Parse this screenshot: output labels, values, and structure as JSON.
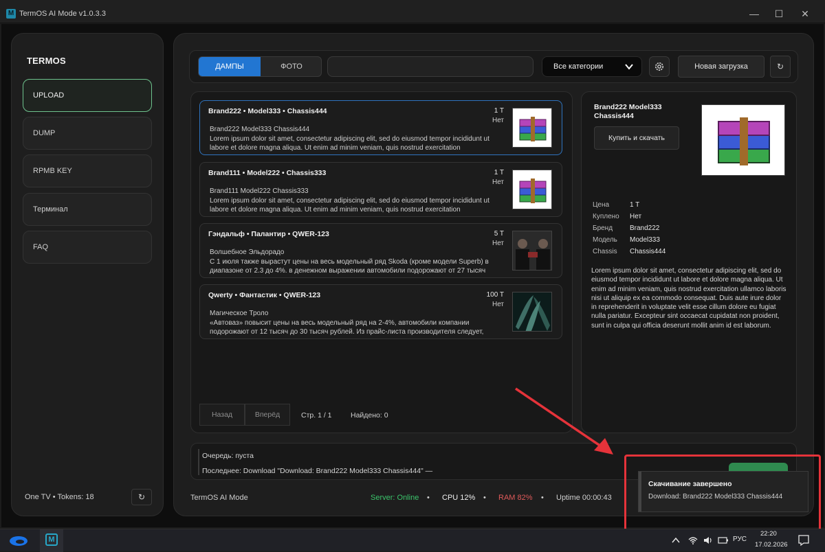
{
  "window": {
    "title": "TermOS AI Mode v1.0.3.3",
    "controls": {
      "minimize": "—",
      "maximize": "☐",
      "close": "✕"
    }
  },
  "sidebar": {
    "brand": "TERMOS",
    "items": [
      {
        "label": "UPLOAD",
        "active": true
      },
      {
        "label": "DUMP"
      },
      {
        "label": "RPMB KEY"
      },
      {
        "label": "Терминал"
      },
      {
        "label": "FAQ"
      }
    ],
    "footer": "One TV • Tokens: 18",
    "refresh_icon": "↻"
  },
  "toolbar": {
    "tabs": [
      {
        "label": "ДАМПЫ",
        "selected": true
      },
      {
        "label": "ФОТО"
      }
    ],
    "search": {
      "value": "",
      "placeholder": ""
    },
    "category": {
      "selected": "Все категории"
    },
    "new_upload_label": "Новая загрузка",
    "refresh_icon": "↻",
    "accent": "#2276d2"
  },
  "list": {
    "items": [
      {
        "title": "Brand222 • Model333 • Chassis444",
        "price": "1 T",
        "bought": "Нет",
        "subtitle": "Brand222 Model333 Chassis444",
        "desc": "Lorem ipsum dolor sit amet, consectetur adipiscing elit, sed do eiusmod tempor incididunt ut labore et dolore magna aliqua. Ut enim ad minim veniam, quis nostrud exercitation",
        "thumb": "archive-icon",
        "selected": true
      },
      {
        "title": "Brand111 • Model222 • Chassis333",
        "price": "1 T",
        "bought": "Нет",
        "subtitle": "Brand111 Model222 Chassis333",
        "desc": "Lorem ipsum dolor sit amet, consectetur adipiscing elit, sed do eiusmod tempor incididunt ut labore et dolore magna aliqua. Ut enim ad minim veniam, quis nostrud exercitation",
        "thumb": "archive-icon"
      },
      {
        "title": "Гэндальф • Палантир • QWER-123",
        "price": "5 T",
        "bought": "Нет",
        "subtitle": "Волшебное Эльдорадо",
        "desc": "С 1 июля также вырастут цены на весь модельный ряд Skoda (кроме модели Superb) в диапазоне от 2.3 до 4%. в денежном выражении автомобили подорожают от 27 тысяч",
        "thumb": "photo-people"
      },
      {
        "title": "Qwerty • Фантастик • QWER-123",
        "price": "100 T",
        "bought": "Нет",
        "subtitle": "Магическое Троло",
        "desc": "«Автоваз» повысит цены на весь модельный ряд на 2-4%, автомобили компании подорожают от 12 тысяч до 30 тысяч рублей. Из прайс-листа производителя следует,",
        "thumb": "photo-leaves"
      }
    ],
    "pager": {
      "prev": "Назад",
      "next": "Вперёд",
      "page": "Стр. 1 / 1",
      "found": "Найдено: 0"
    }
  },
  "detail": {
    "title": "Brand222 Model333 Chassis444",
    "buy_label": "Купить и скачать",
    "thumb": "archive-icon",
    "fields": [
      {
        "k": "Цена",
        "v": "1 T"
      },
      {
        "k": "Куплено",
        "v": "Нет"
      },
      {
        "k": "Бренд",
        "v": "Brand222"
      },
      {
        "k": "Модель",
        "v": "Model333"
      },
      {
        "k": "Chassis",
        "v": "Chassis444"
      }
    ],
    "desc": "Lorem ipsum dolor sit amet, consectetur adipiscing elit, sed do eiusmod tempor incididunt ut labore et dolore magna aliqua. Ut enim ad minim veniam, quis nostrud exercitation ullamco laboris nisi ut aliquip ex ea commodo consequat. Duis aute irure dolor in reprehenderit in voluptate velit esse cillum dolore eu fugiat nulla pariatur. Excepteur sint occaecat cupidatat non proident, sunt in culpa qui officia deserunt mollit anim id est laborum."
  },
  "queue": {
    "line1": "Очередь: пуста",
    "line2": "Последнее: Download \"Download: Brand222 Model333 Chassis444\" —"
  },
  "status": {
    "app": "TermOS AI Mode",
    "server": "Server: Online",
    "cpu": "CPU 12%",
    "ram": "RAM 82%",
    "uptime": "Uptime 00:00:43",
    "sep": "•",
    "colors": {
      "server": "#3bc46b",
      "ram": "#e05a5a",
      "cpu": "#f0f0f0"
    }
  },
  "toast": {
    "title": "Скачивание завершено",
    "body": "Download: Brand222 Model333 Chassis444",
    "highlight_color": "#e5333a"
  },
  "taskbar": {
    "lang": "РУС",
    "time": "22:20",
    "date": "17.02.2026"
  }
}
